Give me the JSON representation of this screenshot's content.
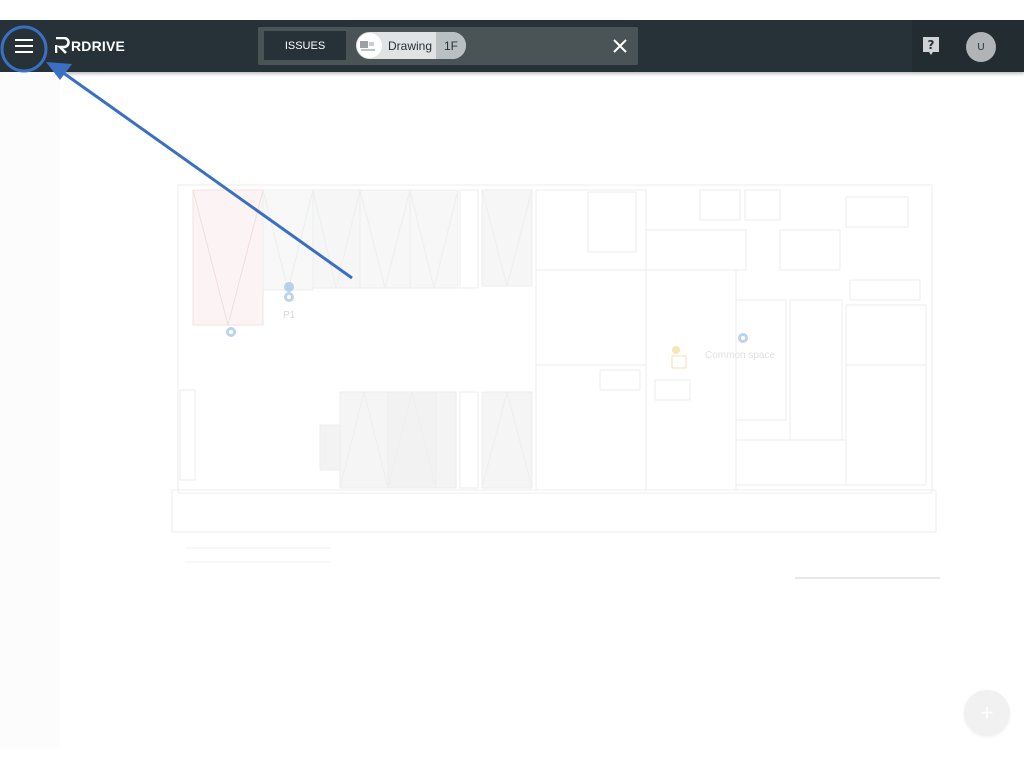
{
  "app": {
    "logo_text": "RDRIVE"
  },
  "header": {
    "menu_icon": "hamburger-menu-icon",
    "issues_label": "ISSUES",
    "drawing_chip": {
      "label": "Drawing",
      "floor": "1F"
    },
    "close_icon": "close-icon",
    "help_icon": "help-icon",
    "avatar_initial": "U"
  },
  "floorplan": {
    "pin_labels": [
      "P1",
      "Common space"
    ]
  },
  "fab": {
    "icon": "plus-icon",
    "label": "+"
  },
  "colors": {
    "topbar": "#263238",
    "annotation": "#3a6fc4",
    "pin": "#9cc2e6"
  }
}
